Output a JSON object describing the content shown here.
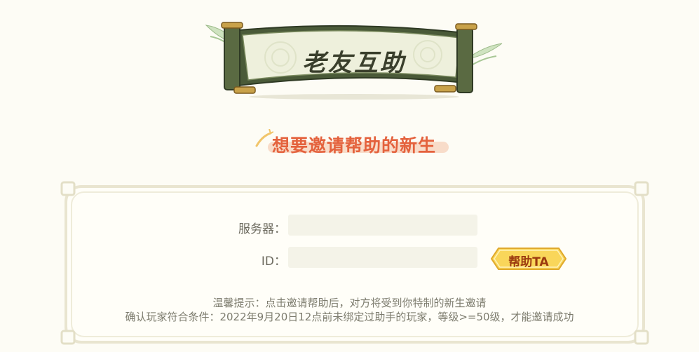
{
  "header": {
    "title": "老友互助"
  },
  "section": {
    "subtitle": "想要邀请帮助的新生"
  },
  "form": {
    "server_label": "服务器：",
    "server_value": "",
    "id_label": "ID：",
    "id_value": "",
    "help_button": "帮助TA"
  },
  "tips": {
    "line1": "温馨提示：点击邀请帮助后，对方将受到你特制的新生邀请",
    "line2": "确认玩家符合条件：2022年9月20日12点前未绑定过助手的玩家，等级>=50级，才能邀请成功"
  },
  "colors": {
    "background": "#fdfcf5",
    "scroll_green": "#4a5a38",
    "subtitle": "#e4623d",
    "button_yellow": "#f9d65a"
  }
}
